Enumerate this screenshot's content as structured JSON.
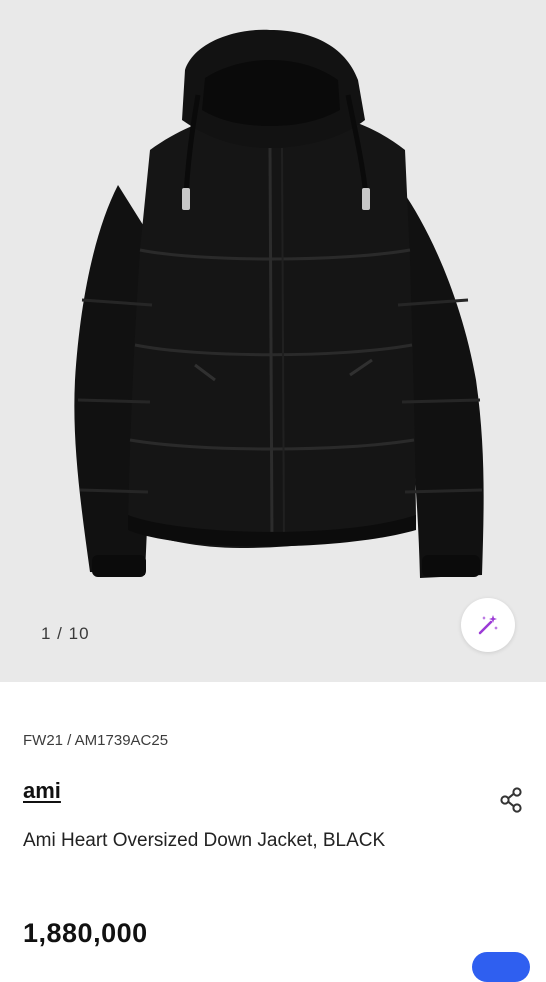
{
  "gallery": {
    "image_alt": "Ami Heart Oversized Down Jacket black product photo",
    "counter": "1 / 10",
    "magic_button_icon": "magic-wand-icon",
    "magic_button_color": "#9b3ad6"
  },
  "product": {
    "season_code": "FW21 / AM1739AC25",
    "brand": "ami",
    "title": "Ami Heart Oversized Down Jacket, BLACK",
    "price": "1,880,000",
    "share_icon": "share-icon"
  },
  "colors": {
    "gallery_bg": "#e9e9e9",
    "accent": "#2f5ff0"
  }
}
